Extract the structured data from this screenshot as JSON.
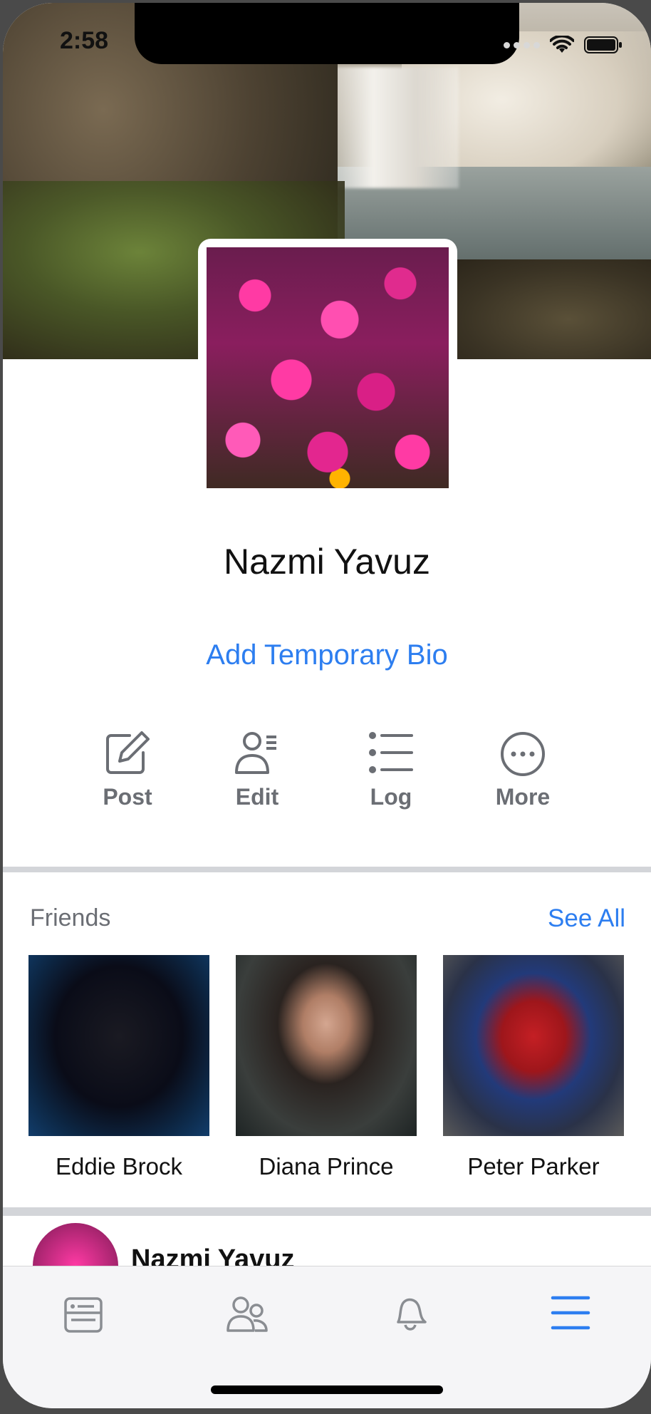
{
  "status_bar": {
    "time": "2:58"
  },
  "profile": {
    "name": "Nazmi Yavuz",
    "bio_link": "Add Temporary Bio"
  },
  "actions": [
    {
      "label": "Post",
      "icon": "compose-icon"
    },
    {
      "label": "Edit",
      "icon": "edit-profile-icon"
    },
    {
      "label": "Log",
      "icon": "list-icon"
    },
    {
      "label": "More",
      "icon": "more-icon"
    }
  ],
  "friends": {
    "title": "Friends",
    "see_all": "See All",
    "items": [
      {
        "name": "Eddie Brock"
      },
      {
        "name": "Diana Prince"
      },
      {
        "name": "Peter Parker"
      }
    ]
  },
  "post": {
    "author": "Nazmi Yavuz",
    "more": "•••"
  },
  "tab_bar": {
    "tabs": [
      {
        "icon": "news-feed-icon",
        "active": false
      },
      {
        "icon": "friends-icon",
        "active": false
      },
      {
        "icon": "notifications-bell-icon",
        "active": false
      },
      {
        "icon": "menu-icon",
        "active": true
      }
    ]
  },
  "colors": {
    "accent": "#2d7ef0",
    "label_gray": "#6b6e74",
    "divider": "#d3d5d9"
  }
}
